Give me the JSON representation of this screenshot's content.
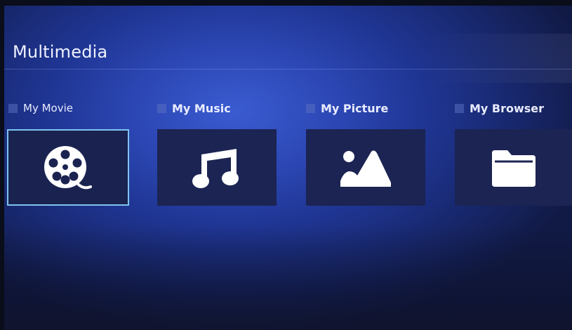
{
  "header": {
    "title": "Multimedia"
  },
  "items": [
    {
      "label": "My Movie",
      "icon": "film-reel-icon",
      "selected": true
    },
    {
      "label": "My Music",
      "icon": "music-note-icon",
      "selected": false
    },
    {
      "label": "My Picture",
      "icon": "picture-icon",
      "selected": false
    },
    {
      "label": "My Browser",
      "icon": "folder-icon",
      "selected": false
    }
  ],
  "colors": {
    "background": "#2c47b4",
    "tile": "#1b2452",
    "selection_border": "#7fc4ee",
    "text": "#eef1ff"
  }
}
